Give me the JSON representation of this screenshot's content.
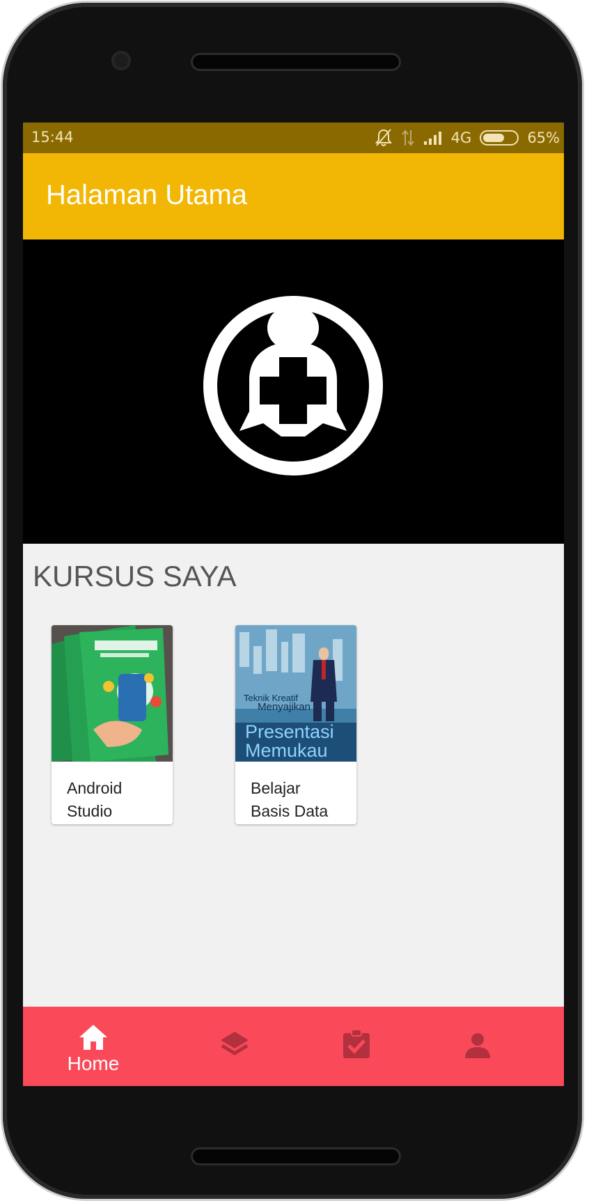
{
  "status_bar": {
    "time": "15:44",
    "network": "4G",
    "battery": "65%",
    "battery_level": 0.65,
    "icons": [
      "bell-off-icon",
      "data-arrows-icon",
      "signal-icon",
      "battery-icon"
    ]
  },
  "app_bar": {
    "title": "Halaman Utama"
  },
  "banner": {
    "icon": "medical-cross-logo-icon"
  },
  "section": {
    "title": "KURSUS SAYA"
  },
  "courses": [
    {
      "title_line1": "Android",
      "title_line2": "Studio",
      "cover": "android-studio-book-cover"
    },
    {
      "title_line1": "Belajar",
      "title_line2": "Basis Data",
      "cover": "presentasi-memukau-book-cover",
      "cover_text": {
        "line1": "Teknik Kreatif",
        "line2": "Menyajikan",
        "line3": "Presentasi",
        "line4": "Memukau"
      }
    }
  ],
  "bottom_nav": {
    "items": [
      {
        "label": "Home",
        "icon": "home-icon",
        "active": true
      },
      {
        "label": "",
        "icon": "layers-icon",
        "active": false
      },
      {
        "label": "",
        "icon": "clipboard-check-icon",
        "active": false
      },
      {
        "label": "",
        "icon": "person-icon",
        "active": false
      }
    ]
  },
  "colors": {
    "status_bar": "#8a6a00",
    "app_bar": "#f2b705",
    "bottom_nav": "#fa4a5a",
    "inactive_icon": "#b3303f"
  }
}
